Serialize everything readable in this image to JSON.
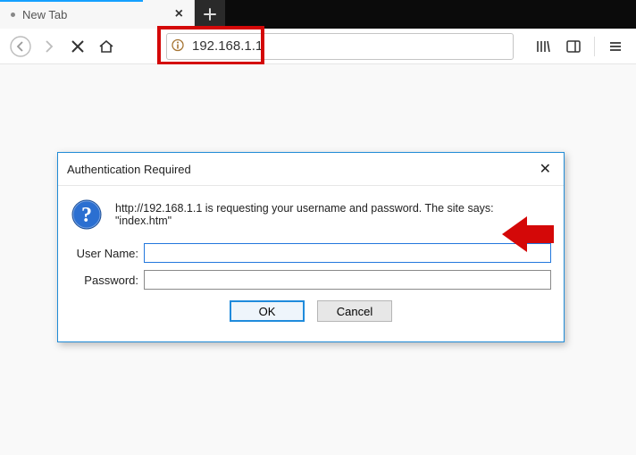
{
  "tab": {
    "title": "New Tab"
  },
  "url": {
    "value": "192.168.1.1"
  },
  "dialog": {
    "title": "Authentication Required",
    "message": "http://192.168.1.1 is requesting your username and password. The site says: \"index.htm\"",
    "username_label": "User Name:",
    "password_label": "Password:",
    "username_value": "",
    "password_value": "",
    "ok_label": "OK",
    "cancel_label": "Cancel"
  }
}
